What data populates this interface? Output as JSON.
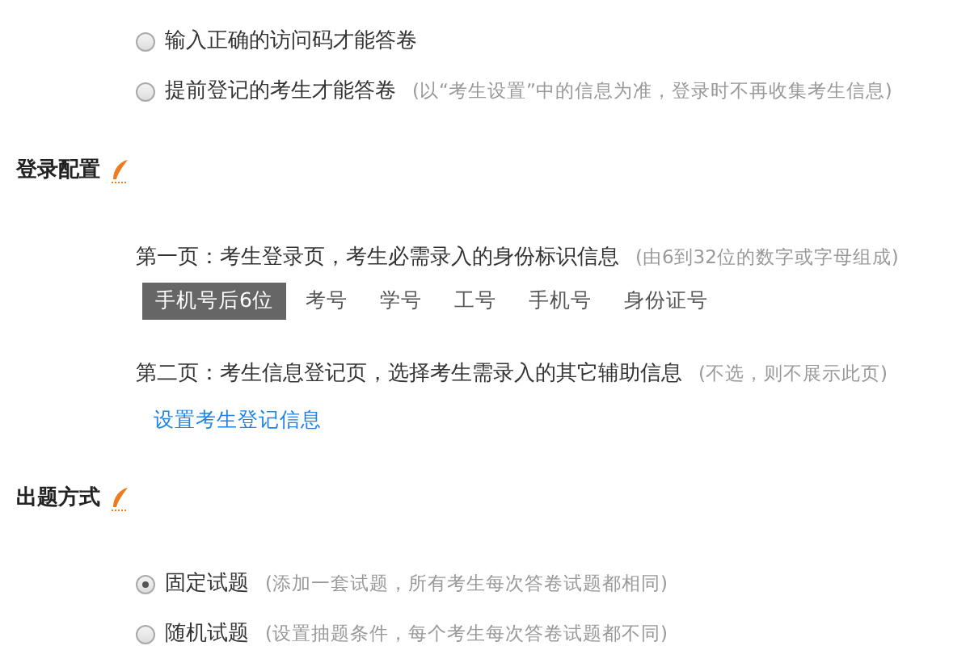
{
  "access_options": [
    {
      "label": "输入正确的访问码才能答卷",
      "selected": false
    },
    {
      "label": "提前登记的考生才能答卷",
      "hint": "(以“考生设置”中的信息为准，登录时不再收集考生信息)",
      "selected": false
    }
  ],
  "login_config": {
    "title": "登录配置",
    "page_one": {
      "text": "第一页：考生登录页，考生必需录入的身份标识信息",
      "hint": "(由6到32位的数字或字母组成)",
      "tags": [
        {
          "label": "手机号后6位",
          "selected": true
        },
        {
          "label": "考号",
          "selected": false
        },
        {
          "label": "学号",
          "selected": false
        },
        {
          "label": "工号",
          "selected": false
        },
        {
          "label": "手机号",
          "selected": false
        },
        {
          "label": "身份证号",
          "selected": false
        }
      ]
    },
    "page_two": {
      "text": "第二页：考生信息登记页，选择考生需录入的其它辅助信息",
      "hint": "(不选，则不展示此页)",
      "link": "设置考生登记信息"
    }
  },
  "question_mode": {
    "title": "出题方式",
    "options": [
      {
        "label": "固定试题",
        "hint": "(添加一套试题，所有考生每次答卷试题都相同)",
        "selected": true
      },
      {
        "label": "随机试题",
        "hint": "(设置抽题条件，每个考生每次答卷试题都不同)",
        "selected": false
      }
    ]
  }
}
